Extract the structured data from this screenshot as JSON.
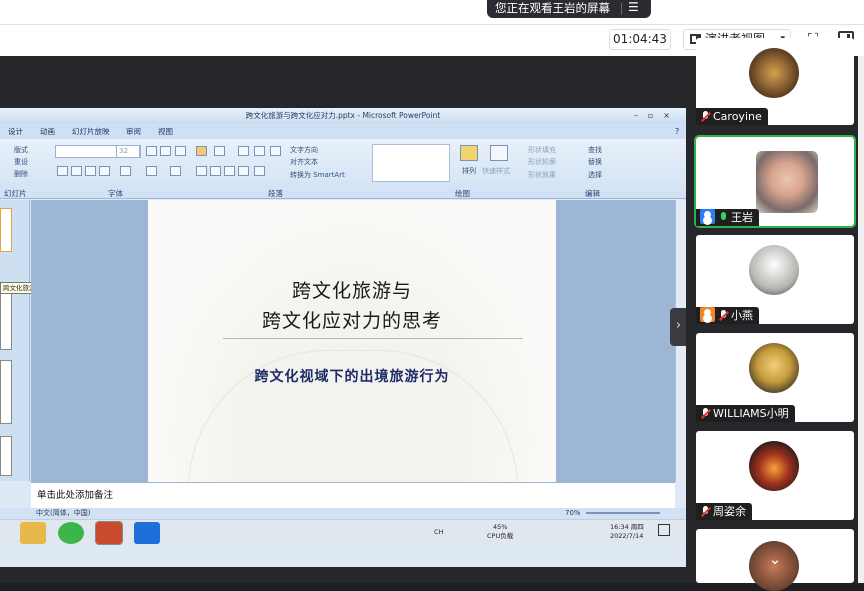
{
  "banner": {
    "text": "您正在观看王岩的屏幕",
    "menu": "☰"
  },
  "toolbar": {
    "timer": "01:04:43",
    "presenter_view_label": "演讲者视图",
    "caret": "▾",
    "fullscreen": "⛶"
  },
  "ppt": {
    "window_title": "跨文化旅游与跨文化应对力.pptx - Microsoft PowerPoint",
    "window_buttons": "–▫×",
    "tabs": [
      "设计",
      "动画",
      "幻灯片放映",
      "审阅",
      "视图"
    ],
    "groups": [
      "幻灯片",
      "字体",
      "段落",
      "绘图",
      "编辑"
    ],
    "clipboard_items": [
      "版式",
      "重设",
      "删除"
    ],
    "font_size": "32",
    "paragraph_items": [
      "文字方向",
      "对齐文本",
      "转换为 SmartArt"
    ],
    "draw_items": [
      "排列",
      "快速样式",
      "形状填充",
      "形状轮廓",
      "形状效果"
    ],
    "edit_items": [
      "查找",
      "替换",
      "选择"
    ],
    "tooltip": "跨文化旅游与 跨文化应对力的思考",
    "slide": {
      "title_line1": "跨文化旅游与",
      "title_line2": "跨文化应对力的思考",
      "subtitle": "跨文化视域下的出境旅游行为"
    },
    "notes_placeholder": "单击此处添加备注",
    "status_lang": "中文(简体，中国)",
    "zoom": "70%"
  },
  "taskbar": {
    "cpu_pct": "45%",
    "cpu_label": "CPU负载",
    "time": "16:34 周四",
    "date": "2022/7/14",
    "ime": "CH"
  },
  "participants": [
    {
      "name": "Caroyine",
      "muted": true,
      "host": false,
      "avatar_color": "#8a5a2c"
    },
    {
      "name": "王岩",
      "muted": false,
      "host": true,
      "avatar_color": "#d8a48d"
    },
    {
      "name": "小燕",
      "muted": true,
      "host": true,
      "avatar_color": "#b6b6b2"
    },
    {
      "name": "WILLIAMS小明",
      "muted": true,
      "host": false,
      "avatar_color": "#c49a3a"
    },
    {
      "name": "周姿余",
      "muted": true,
      "host": false,
      "avatar_color": "#a2321e"
    }
  ],
  "scroll_down": "⌄",
  "panel_toggle": "›"
}
